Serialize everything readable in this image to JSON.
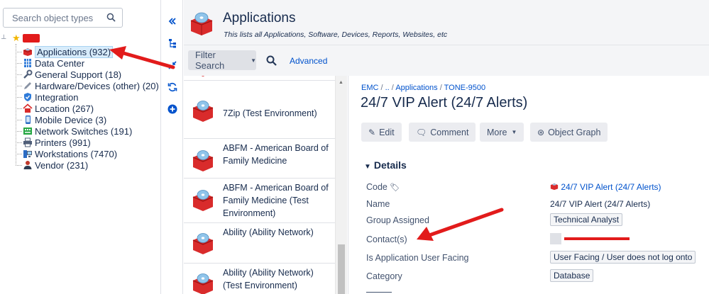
{
  "search": {
    "placeholder": "Search object types",
    "icon": "search-icon"
  },
  "tree": {
    "root_icon": "star-icon",
    "items": [
      {
        "label": "Applications (932)",
        "icon": "application-cube-icon",
        "selected": true
      },
      {
        "label": "Data Center",
        "icon": "grid-icon"
      },
      {
        "label": "General Support (18)",
        "icon": "wrench-icon"
      },
      {
        "label": "Hardware/Devices (other) (20)",
        "icon": "pencil-icon"
      },
      {
        "label": "Integration",
        "icon": "shield-icon"
      },
      {
        "label": "Location (267)",
        "icon": "home-icon"
      },
      {
        "label": "Mobile Device (3)",
        "icon": "phone-icon"
      },
      {
        "label": "Network Switches (191)",
        "icon": "switch-icon"
      },
      {
        "label": "Printers (991)",
        "icon": "printer-icon"
      },
      {
        "label": "Workstations (7470)",
        "icon": "workstation-icon"
      },
      {
        "label": "Vendor (231)",
        "icon": "person-icon"
      }
    ]
  },
  "toolbar": {
    "buttons": [
      "collapse-left-icon",
      "hierarchy-icon",
      "minimize-icon",
      "refresh-icon",
      "add-icon"
    ]
  },
  "header": {
    "title": "Applications",
    "subtitle": "This lists all Applications, Software, Devices, Reports, Websites, etc"
  },
  "filter": {
    "button_label": "Filter Search",
    "advanced_label": "Advanced"
  },
  "list": {
    "items": [
      {
        "label": ""
      },
      {
        "label": "7Zip (Test Environment)"
      },
      {
        "label": "ABFM - American Board of Family Medicine"
      },
      {
        "label": "ABFM - American Board of Family Medicine (Test Environment)"
      },
      {
        "label": "Ability (Ability Network)"
      },
      {
        "label": "Ability (Ability Network) (Test Environment)"
      }
    ]
  },
  "detail": {
    "breadcrumb": {
      "root": "EMC",
      "sep": " / ",
      "mid": "..",
      "parent": "Applications",
      "key": "TONE-9500"
    },
    "title": "24/7 VIP Alert (24/7 Alerts)",
    "actions": {
      "edit": "Edit",
      "comment": "Comment",
      "more": "More",
      "graph": "Object Graph"
    },
    "section": "Details",
    "fields": {
      "code_label": "Code",
      "code_value": "24/7 VIP Alert (24/7 Alerts)",
      "name_label": "Name",
      "name_value": "24/7 VIP Alert (24/7 Alerts)",
      "group_label": "Group Assigned",
      "group_value": "Technical Analyst",
      "contacts_label": "Contact(s)",
      "facing_label": "Is Application User Facing",
      "facing_value": "User Facing / User does not log onto",
      "category_label": "Category",
      "category_value": "Database"
    }
  },
  "colors": {
    "accent": "#0052cc",
    "annotation": "#e21b1b",
    "header_bg": "#f4f5f7"
  }
}
